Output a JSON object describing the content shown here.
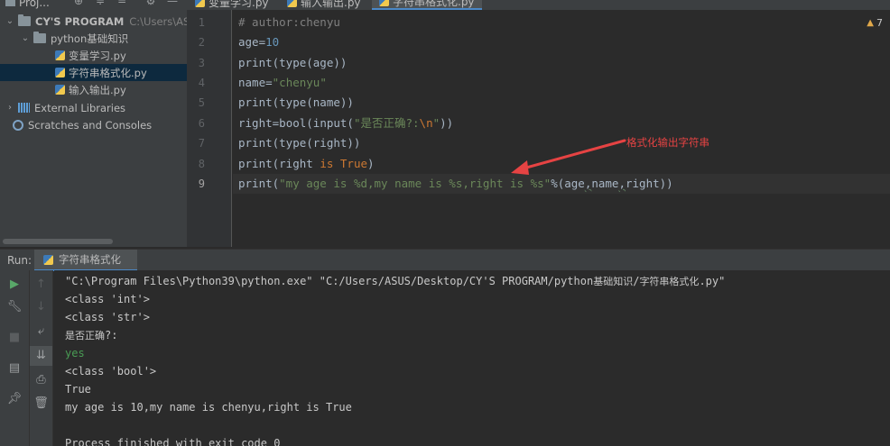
{
  "top_tabs": {
    "project_label": "Proj...",
    "tabs": [
      {
        "label": "变量学习.py"
      },
      {
        "label": "输入输出.py"
      },
      {
        "label": "字符串格式化.py"
      }
    ]
  },
  "project_tree": {
    "root": {
      "label": "CY'S PROGRAM",
      "path": "C:\\Users\\ASUS\\"
    },
    "folder": {
      "label": "python基础知识"
    },
    "files": [
      {
        "label": "变量学习.py"
      },
      {
        "label": "字符串格式化.py"
      },
      {
        "label": "输入输出.py"
      }
    ],
    "external_libraries": "External Libraries",
    "scratches": "Scratches and Consoles"
  },
  "editor": {
    "line_numbers": [
      "1",
      "2",
      "3",
      "4",
      "5",
      "6",
      "7",
      "8",
      "9"
    ],
    "warning_count": "7",
    "lines": {
      "l1": "# author:chenyu",
      "l2_name": "age",
      "l2_eq": "=",
      "l2_val": "10",
      "l3": "print(type(age))",
      "l4_name": "name",
      "l4_eq": "=",
      "l4_val": "\"chenyu\"",
      "l5": "print(type(name))",
      "l6_a": "right",
      "l6_eq": "=",
      "l6_b": "bool(input(",
      "l6_s1": "\"是否正确?:",
      "l6_esc": "\\n",
      "l6_s2": "\"",
      "l6_c": "))",
      "l7": "print(type(right))",
      "l8_a": "print(right ",
      "l8_is": "is",
      "l8_sp": " ",
      "l8_true": "True",
      "l8_b": ")",
      "l9_a": "print(",
      "l9_str": "\"my age is %d,my name is %s,right is %s\"",
      "l9_b": "%(age",
      "l9_c1": ",",
      "l9_name": "name",
      "l9_c2": ",",
      "l9_c": "right))"
    },
    "annotation": "格式化输出字符串",
    "annotation_color": "#e64343"
  },
  "run_panel": {
    "label": "Run:",
    "tab": "字符串格式化",
    "output": {
      "cmd_a": "\"C:\\Program Files\\Python39\\python.exe\" \"C:/Users/ASUS/Desktop/CY'S PROGRAM/python",
      "cmd_cjk1": "基础知识",
      "cmd_b": "/",
      "cmd_cjk2": "字符串格式化",
      "cmd_c": ".py\"",
      "o2": "<class 'int'>",
      "o3": "<class 'str'>",
      "o4_cjk": "是否正确",
      "o4_b": "?:",
      "o5": "yes",
      "o6": "<class 'bool'>",
      "o7": "True",
      "o8": "my age is 10,my name is chenyu,right is True",
      "o9": "",
      "o10": "Process finished with exit code 0"
    }
  },
  "colors": {
    "background": "#2b2b2b",
    "panel": "#3c3f41",
    "keyword": "#cc7832",
    "string": "#6a8759",
    "number": "#6897bb",
    "comment": "#808080",
    "input_echo": "#499c54"
  }
}
